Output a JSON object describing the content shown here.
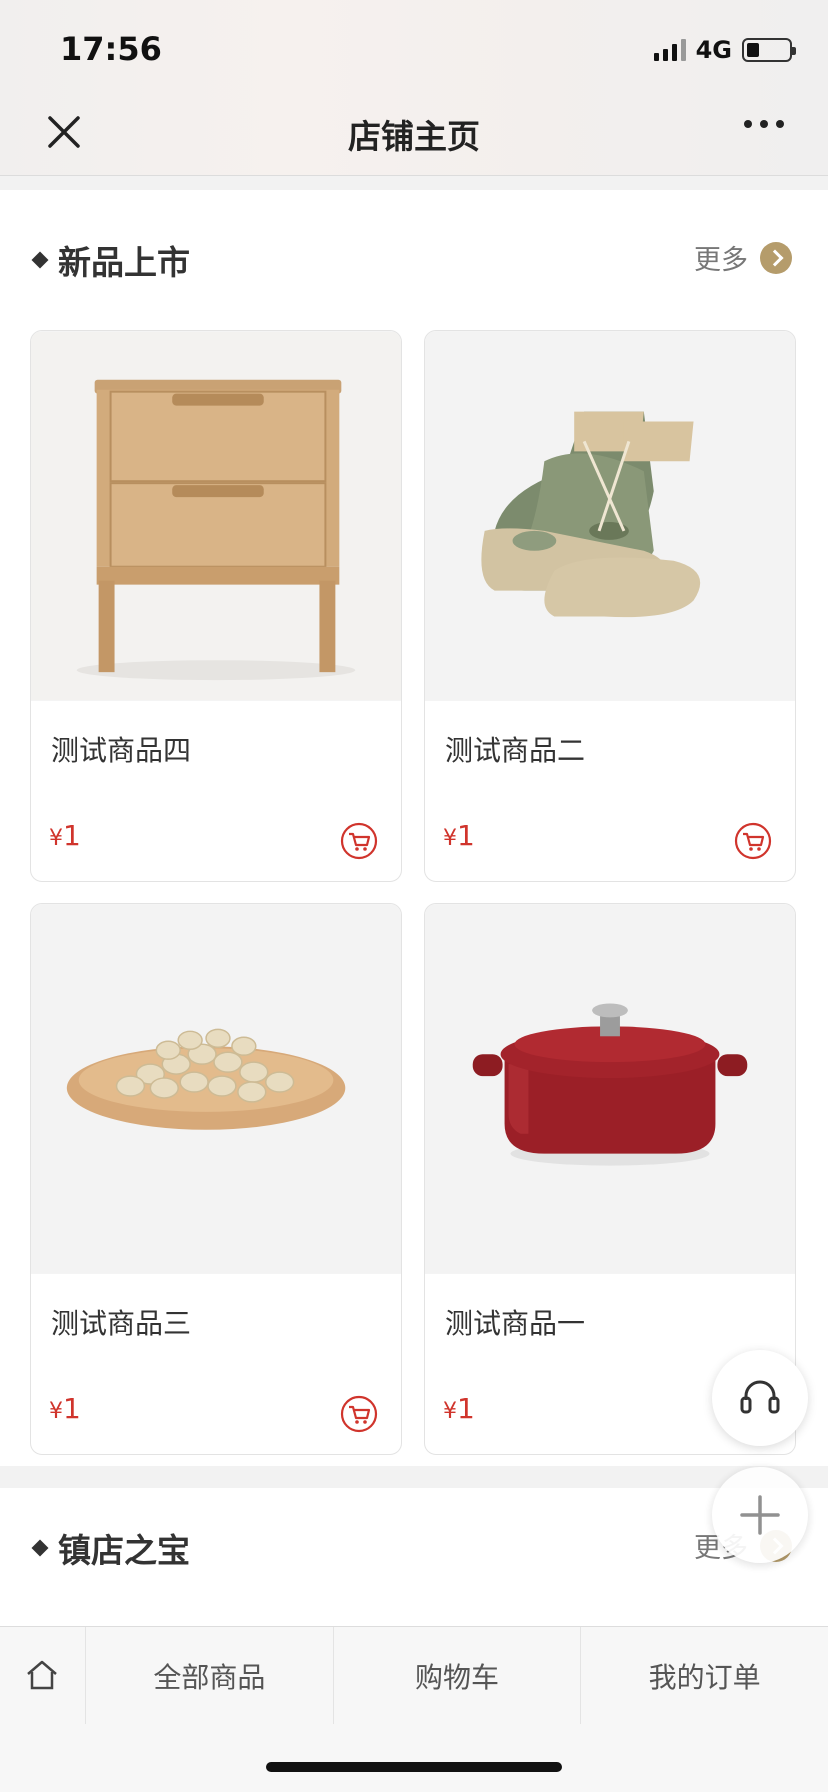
{
  "status_bar": {
    "time": "17:56",
    "network": "4G"
  },
  "nav": {
    "title": "店铺主页"
  },
  "sections": [
    {
      "title": "新品上市",
      "more_label": "更多"
    },
    {
      "title": "镇店之宝",
      "more_label": "更多"
    }
  ],
  "products": [
    {
      "name": "测试商品四",
      "currency": "¥",
      "price": "1",
      "image": "wooden-nightstand"
    },
    {
      "name": "测试商品二",
      "currency": "¥",
      "price": "1",
      "image": "camo-boots"
    },
    {
      "name": "测试商品三",
      "currency": "¥",
      "price": "1",
      "image": "pistachio-plate"
    },
    {
      "name": "测试商品一",
      "currency": "¥",
      "price": "1",
      "image": "red-cast-iron-pot"
    }
  ],
  "tabbar": {
    "items": [
      "全部商品",
      "购物车",
      "我的订单"
    ]
  },
  "colors": {
    "price": "#d0342c",
    "more_accent": "#b59c6b"
  }
}
